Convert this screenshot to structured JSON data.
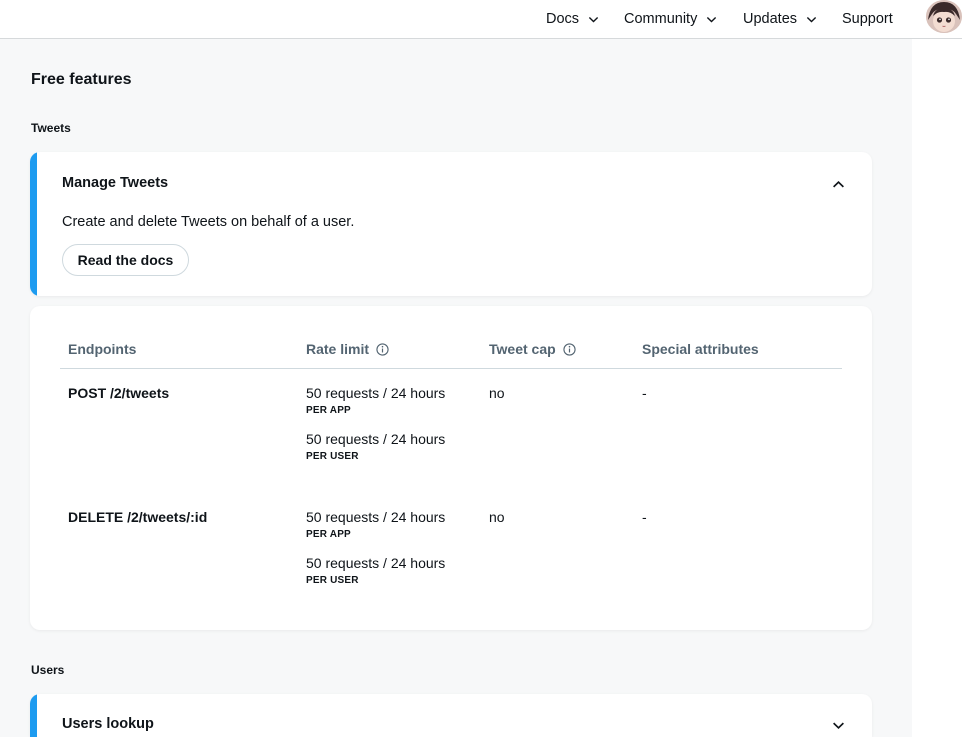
{
  "nav": {
    "items": [
      {
        "label": "Docs",
        "has_dropdown": true
      },
      {
        "label": "Community",
        "has_dropdown": true
      },
      {
        "label": "Updates",
        "has_dropdown": true
      },
      {
        "label": "Support",
        "has_dropdown": false
      }
    ],
    "avatar_icon": "user-avatar-icon"
  },
  "page": {
    "title": "Free features"
  },
  "sections": [
    {
      "heading": "Tweets",
      "cards": [
        {
          "title": "Manage Tweets",
          "expanded": true,
          "description": "Create and delete Tweets on behalf of a user.",
          "docs_button": "Read the docs"
        }
      ],
      "table": {
        "headers": {
          "endpoints": "Endpoints",
          "rate_limit": "Rate limit",
          "tweet_cap": "Tweet cap",
          "special_attributes": "Special attributes"
        },
        "rows": [
          {
            "endpoint": "POST /2/tweets",
            "limits": [
              {
                "value": "50 requests / 24 hours",
                "scope": "PER APP"
              },
              {
                "value": "50 requests / 24 hours",
                "scope": "PER USER"
              }
            ],
            "tweet_cap": "no",
            "special_attributes": "-"
          },
          {
            "endpoint": "DELETE /2/tweets/:id",
            "limits": [
              {
                "value": "50 requests / 24 hours",
                "scope": "PER APP"
              },
              {
                "value": "50 requests / 24 hours",
                "scope": "PER USER"
              }
            ],
            "tweet_cap": "no",
            "special_attributes": "-"
          }
        ]
      }
    },
    {
      "heading": "Users",
      "cards": [
        {
          "title": "Users lookup",
          "expanded": false
        }
      ]
    }
  ],
  "colors": {
    "accent": "#1d9bf0",
    "page_bg": "#f7f8f9",
    "muted_text": "#536471",
    "border": "#cfd9de"
  }
}
